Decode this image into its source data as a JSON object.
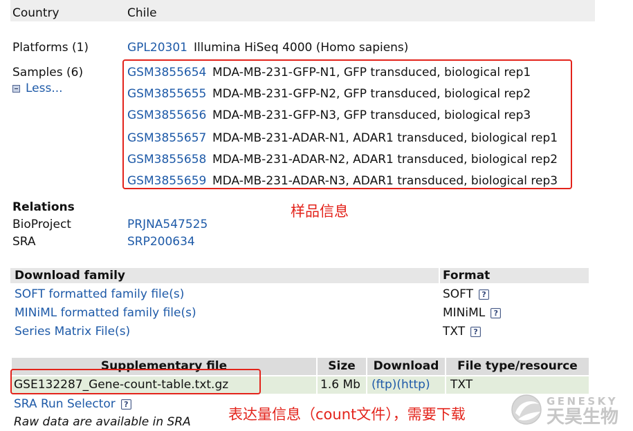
{
  "country_row": {
    "label": "Country",
    "value": "Chile"
  },
  "platforms": {
    "label": "Platforms (1)",
    "items": [
      {
        "accession": "GPL20301",
        "title": "Illumina HiSeq 4000 (Homo sapiens)"
      }
    ]
  },
  "samples": {
    "label": "Samples (6)",
    "toggle_label": "Less...",
    "items": [
      {
        "accession": "GSM3855654",
        "title": "MDA-MB-231-GFP-N1, GFP transduced, biological rep1"
      },
      {
        "accession": "GSM3855655",
        "title": "MDA-MB-231-GFP-N2, GFP transduced, biological rep2"
      },
      {
        "accession": "GSM3855656",
        "title": "MDA-MB-231-GFP-N3, GFP transduced, biological rep3"
      },
      {
        "accession": "GSM3855657",
        "title": "MDA-MB-231-ADAR-N1, ADAR1 transduced, biological rep1"
      },
      {
        "accession": "GSM3855658",
        "title": "MDA-MB-231-ADAR-N2, ADAR1 transduced, biological rep2"
      },
      {
        "accession": "GSM3855659",
        "title": "MDA-MB-231-ADAR-N3, ADAR1 transduced, biological rep3"
      }
    ]
  },
  "relations": {
    "heading": "Relations",
    "items": [
      {
        "label": "BioProject",
        "value": "PRJNA547525"
      },
      {
        "label": "SRA",
        "value": "SRP200634"
      }
    ]
  },
  "download_family": {
    "headers": {
      "name": "Download family",
      "format": "Format"
    },
    "rows": [
      {
        "name": "SOFT formatted family file(s)",
        "format": "SOFT"
      },
      {
        "name": "MINiML formatted family file(s)",
        "format": "MINiML"
      },
      {
        "name": "Series Matrix File(s)",
        "format": "TXT"
      }
    ]
  },
  "supplementary": {
    "headers": {
      "file": "Supplementary file",
      "size": "Size",
      "download": "Download",
      "type": "File type/resource"
    },
    "rows": [
      {
        "file": "GSE132287_Gene-count-table.txt.gz",
        "size": "1.6 Mb",
        "ftp": "(ftp)",
        "http": "(http)",
        "type": "TXT"
      }
    ]
  },
  "sra_run_selector": {
    "label": "SRA Run Selector"
  },
  "raw_data_note": "Raw data are available in SRA",
  "help_icon": {
    "glyph": "?"
  },
  "icons": {
    "help": "help-icon",
    "collapse": "minus-box-icon",
    "logo": "genesky-logo-icon"
  },
  "annotations": {
    "samples_note": "样品信息",
    "supplementary_note": "表达量信息（count文件），需要下载"
  },
  "watermark": {
    "brand": "GENESKY",
    "name_cn": "天昊生物"
  },
  "colors": {
    "link": "#1e5aa8",
    "text": "#111111",
    "top_row_bg": "#eeeeee",
    "download_header_bg": "#e6e6e6",
    "supplementary_header_bg": "#dcdcdc",
    "file_row_bg": "#e3eddc",
    "annotation_red": "#e3231b",
    "watermark_gray": "#c6c6c6"
  }
}
